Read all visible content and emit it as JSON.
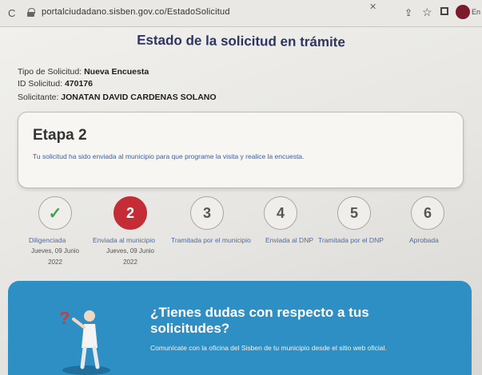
{
  "browser": {
    "url": "portalciudadano.sisben.gov.co/EstadoSolicitud",
    "profile_label": "En"
  },
  "page": {
    "title": "Estado de la solicitud en trámite",
    "tipo_label": "Tipo de Solicitud:",
    "tipo_value": "Nueva Encuesta",
    "id_label": "ID Solicitud:",
    "id_value": "470176",
    "solicitante_label": "Solicitante:",
    "solicitante_value": "JONATAN DAVID CARDENAS SOLANO"
  },
  "stage": {
    "title": "Etapa 2",
    "description": "Tu solicitud ha sido enviada al municipio para que programe la visita y realice la encuesta."
  },
  "steps": [
    {
      "number": "✓",
      "label": "Diligenciada",
      "date": "Jueves, 09 Junio",
      "year": "2022",
      "state": "done"
    },
    {
      "number": "2",
      "label": "Enviada al municipio",
      "date": "Jueves, 09 Junio",
      "year": "2022",
      "state": "active"
    },
    {
      "number": "3",
      "label": "Tramitada por el municipio",
      "date": "",
      "year": "",
      "state": "pending"
    },
    {
      "number": "4",
      "label": "Enviada al DNP",
      "date": "",
      "year": "",
      "state": "pending"
    },
    {
      "number": "5",
      "label": "Tramitada por el DNP",
      "date": "",
      "year": "",
      "state": "pending"
    },
    {
      "number": "6",
      "label": "Aprobada",
      "date": "",
      "year": "",
      "state": "pending"
    }
  ],
  "help_banner": {
    "title": "¿Tienes dudas con respecto a tus solicitudes?",
    "text": "Comunícate con la oficina del Sisben de tu municipio desde el sitio web oficial."
  },
  "colors": {
    "accent_red": "#c42d35",
    "check_green": "#3aa64a",
    "banner_blue": "#2d8fc4",
    "title_navy": "#2d3560"
  }
}
